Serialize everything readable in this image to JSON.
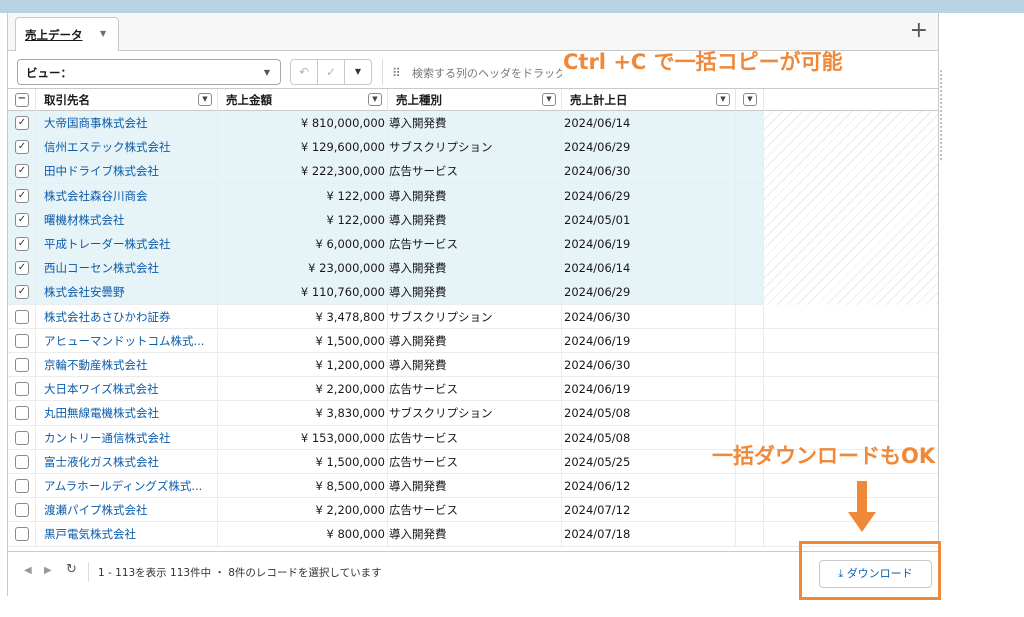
{
  "tab": {
    "label": "売上データ"
  },
  "toolbar": {
    "view_label": "ビュー：",
    "search_hint": "検索する列のヘッダをドラッグ"
  },
  "columns": [
    "取引先名",
    "売上金額",
    "売上種別",
    "売上計上日"
  ],
  "rows": [
    {
      "name": "大帝国商事株式会社",
      "amount": "¥ 810,000,000",
      "type": "導入開発費",
      "date": "2024/06/14",
      "selected": true
    },
    {
      "name": "信州エステック株式会社",
      "amount": "¥ 129,600,000",
      "type": "サブスクリプション",
      "date": "2024/06/29",
      "selected": true
    },
    {
      "name": "田中ドライブ株式会社",
      "amount": "¥ 222,300,000",
      "type": "広告サービス",
      "date": "2024/06/30",
      "selected": true
    },
    {
      "name": "株式会社森谷川商会",
      "amount": "¥ 122,000",
      "type": "導入開発費",
      "date": "2024/06/29",
      "selected": true
    },
    {
      "name": "曙機材株式会社",
      "amount": "¥ 122,000",
      "type": "導入開発費",
      "date": "2024/05/01",
      "selected": true
    },
    {
      "name": "平成トレーダー株式会社",
      "amount": "¥ 6,000,000",
      "type": "広告サービス",
      "date": "2024/06/19",
      "selected": true
    },
    {
      "name": "西山コーセン株式会社",
      "amount": "¥ 23,000,000",
      "type": "導入開発費",
      "date": "2024/06/14",
      "selected": true
    },
    {
      "name": "株式会社安曇野",
      "amount": "¥ 110,760,000",
      "type": "導入開発費",
      "date": "2024/06/29",
      "selected": true
    },
    {
      "name": "株式会社あさひかわ証券",
      "amount": "¥ 3,478,800",
      "type": "サブスクリプション",
      "date": "2024/06/30",
      "selected": false
    },
    {
      "name": "アヒューマンドットコム株式...",
      "amount": "¥ 1,500,000",
      "type": "導入開発費",
      "date": "2024/06/19",
      "selected": false
    },
    {
      "name": "京輪不動産株式会社",
      "amount": "¥ 1,200,000",
      "type": "導入開発費",
      "date": "2024/06/30",
      "selected": false
    },
    {
      "name": "大日本ワイズ株式会社",
      "amount": "¥ 2,200,000",
      "type": "広告サービス",
      "date": "2024/06/19",
      "selected": false
    },
    {
      "name": "丸田無線電機株式会社",
      "amount": "¥ 3,830,000",
      "type": "サブスクリプション",
      "date": "2024/05/08",
      "selected": false
    },
    {
      "name": "カントリー通信株式会社",
      "amount": "¥ 153,000,000",
      "type": "広告サービス",
      "date": "2024/05/08",
      "selected": false
    },
    {
      "name": "富士液化ガス株式会社",
      "amount": "¥ 1,500,000",
      "type": "広告サービス",
      "date": "2024/05/25",
      "selected": false
    },
    {
      "name": "アムラホールディングズ株式...",
      "amount": "¥ 8,500,000",
      "type": "導入開発費",
      "date": "2024/06/12",
      "selected": false
    },
    {
      "name": "渡瀬パイプ株式会社",
      "amount": "¥ 2,200,000",
      "type": "広告サービス",
      "date": "2024/07/12",
      "selected": false
    },
    {
      "name": "黒戸電気株式会社",
      "amount": "¥ 800,000",
      "type": "導入開発費",
      "date": "2024/07/18",
      "selected": false
    }
  ],
  "footer": {
    "status": "1 - 113を表示 113件中 ・ 8件のレコードを選択しています",
    "download_label": "ダウンロード"
  },
  "annotations": {
    "copy": "Ctrl +C で一括コピーが可能",
    "download": "一括ダウンロードもOK"
  },
  "colors": {
    "accent": "#f0883a",
    "link": "#0b5cab",
    "selected_row": "#e6f3f7"
  }
}
